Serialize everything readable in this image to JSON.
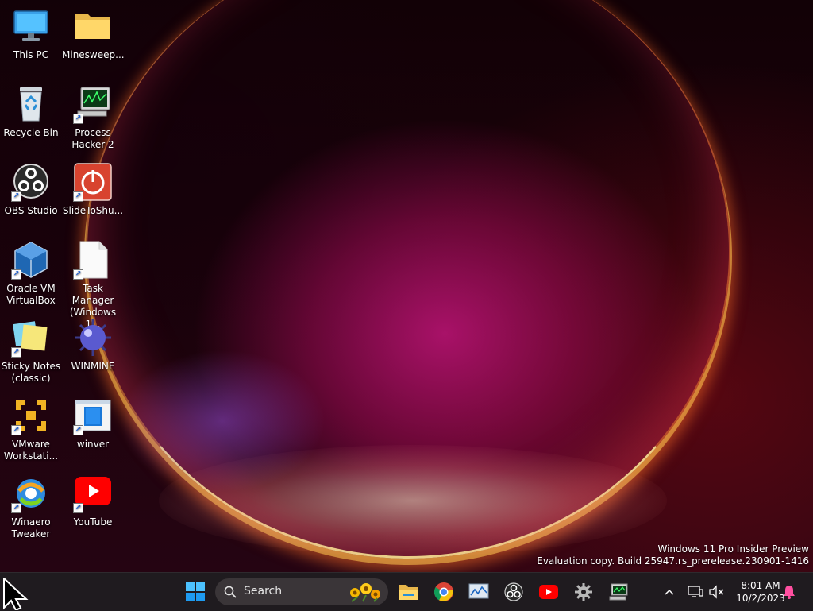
{
  "desktop": {
    "icons": [
      {
        "label": "This PC",
        "icon": "monitor-icon"
      },
      {
        "label": "Minesweep...",
        "icon": "folder-icon"
      },
      {
        "label": "Recycle Bin",
        "icon": "recycle-bin-icon"
      },
      {
        "label": "Process Hacker 2",
        "icon": "process-hacker-icon"
      },
      {
        "label": "OBS Studio",
        "icon": "obs-icon"
      },
      {
        "label": "SlideToShu...",
        "icon": "power-icon"
      },
      {
        "label": "Oracle VM VirtualBox",
        "icon": "virtualbox-icon"
      },
      {
        "label": "Task Manager (Windows 1...",
        "icon": "document-icon"
      },
      {
        "label": "Sticky Notes (classic)",
        "icon": "sticky-notes-icon"
      },
      {
        "label": "WINMINE",
        "icon": "mine-icon"
      },
      {
        "label": "VMware Workstati...",
        "icon": "vmware-icon"
      },
      {
        "label": "winver",
        "icon": "winver-icon"
      },
      {
        "label": "Winaero Tweaker",
        "icon": "winaero-icon"
      },
      {
        "label": "YouTube",
        "icon": "youtube-icon"
      }
    ]
  },
  "watermark": {
    "line1": "Windows 11 Pro Insider Preview",
    "line2": "Evaluation copy. Build 25947.rs_prerelease.230901-1416"
  },
  "taskbar": {
    "search_label": "Search",
    "pinned": [
      "start-icon",
      "file-explorer-icon",
      "chrome-icon",
      "performance-monitor-icon",
      "obs-icon",
      "youtube-icon",
      "settings-gear-icon",
      "remote-desktop-icon"
    ],
    "time": "8:01 AM",
    "date": "10/2/2023"
  },
  "colors": {
    "taskbar": "#1f1b1f",
    "search": "#3a3538",
    "accent": "#0078d4"
  }
}
